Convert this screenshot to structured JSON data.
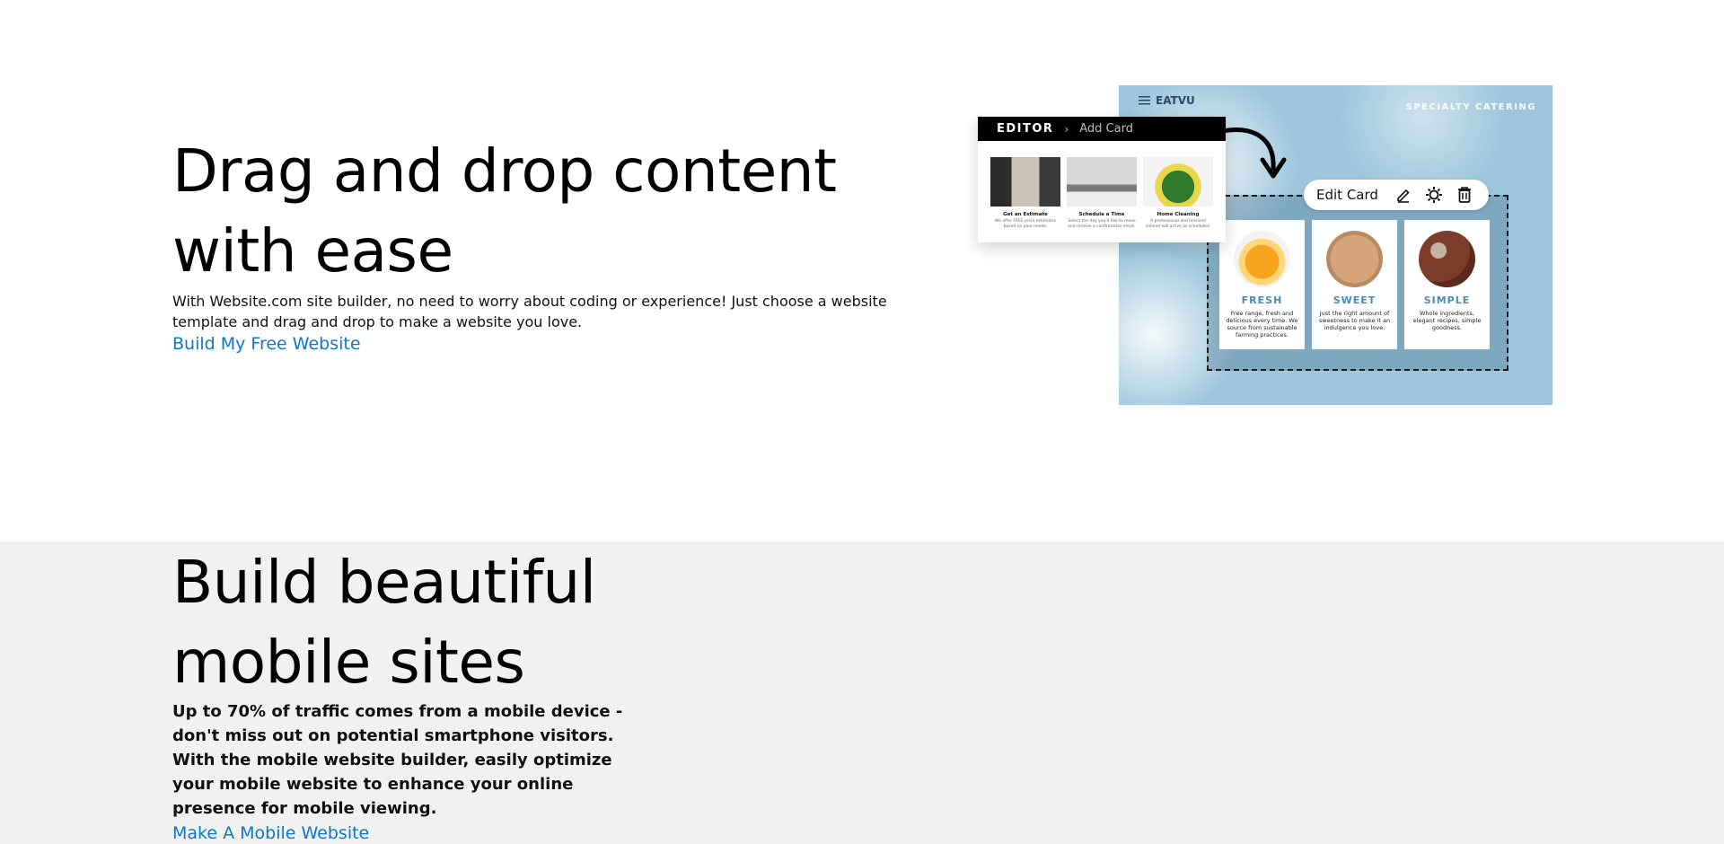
{
  "section_drag": {
    "title": "Drag and drop content with ease",
    "description": "With Website.com site builder, no need to worry about coding or experience! Just choose a website template and drag and drop to make a website you love.",
    "cta": "Build My Free Website"
  },
  "illustration": {
    "brand": "EATVU",
    "tagline": "SPECIALTY CATERING",
    "editor": {
      "title": "EDITOR",
      "crumb": "Add Card",
      "thumbs": [
        {
          "title": "Get an Estimate",
          "desc": "We offer FREE price estimates based on your needs."
        },
        {
          "title": "Schedule a Time",
          "desc": "Select the day you'd like to move and receive a confirmation email."
        },
        {
          "title": "Home Cleaning",
          "desc": "A professional and licensed cleaner will arrive as scheduled."
        }
      ]
    },
    "toolbar": {
      "label": "Edit Card",
      "icons": [
        "edit-icon",
        "settings-icon",
        "trash-icon"
      ]
    },
    "cards": [
      {
        "title": "FRESH",
        "desc": "Free range, fresh and delicious every time. We source from sustainable farming practices."
      },
      {
        "title": "SWEET",
        "desc": "Just the right amount of sweetness to make it an indulgence you love."
      },
      {
        "title": "SIMPLE",
        "desc": "Whole ingredients, elegant recipes, simple goodness."
      }
    ]
  },
  "section_mobile": {
    "title": "Build beautiful mobile sites",
    "description": "Up to 70% of traffic comes from a mobile device - don't miss out on potential smartphone visitors. With the mobile website builder, easily optimize your mobile website to enhance your online presence for mobile viewing.",
    "cta": "Make A Mobile Website"
  },
  "colors": {
    "link": "#0b79c7",
    "section2_bg": "#f1f1f1",
    "card_title": "#4b8db0"
  }
}
